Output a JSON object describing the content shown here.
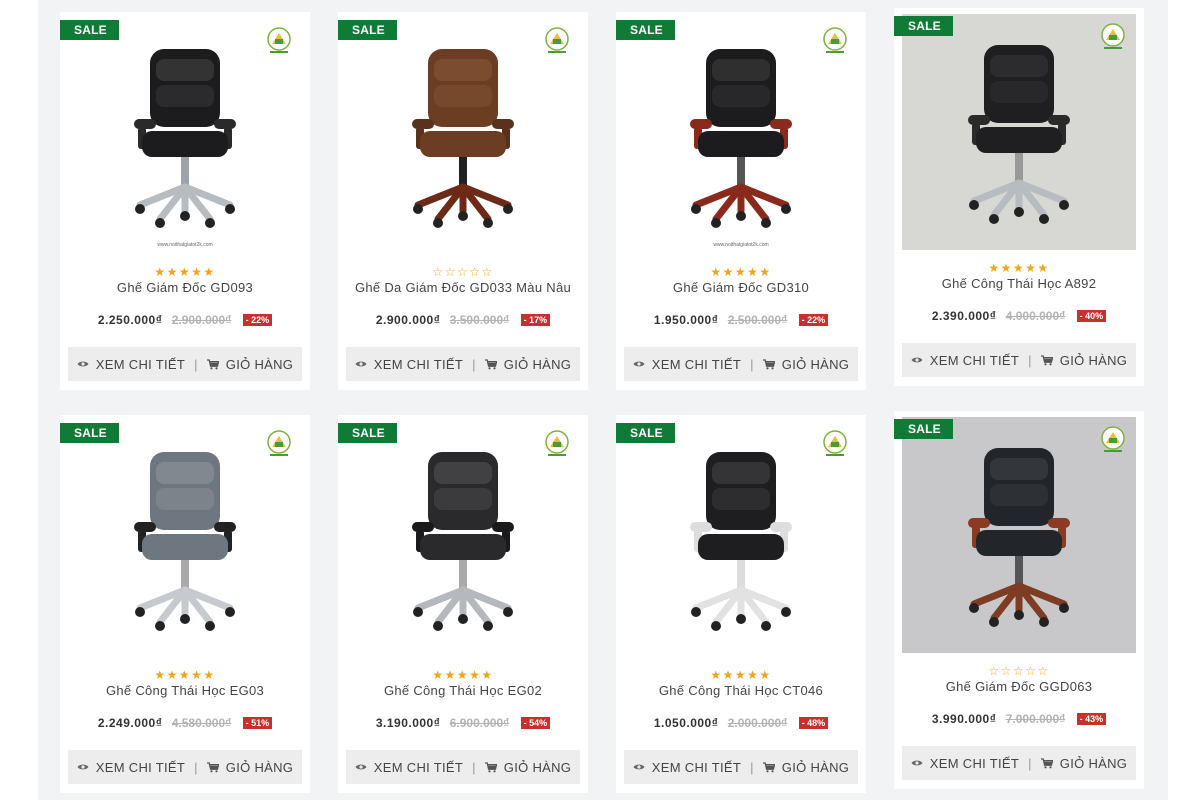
{
  "products": [
    {
      "name": "Ghế Giám Đốc GD093",
      "price": "2.250.000₫",
      "old_price": "2.900.000₫",
      "discount": "- 22%",
      "sale": "SALE",
      "rating": 5,
      "watermark": "www.noithatgiatot2k.com",
      "bg": "white"
    },
    {
      "name": "Ghế Da Giám Đốc GD033 Màu Nâu",
      "price": "2.900.000₫",
      "old_price": "3.500.000₫",
      "discount": "- 17%",
      "sale": "SALE",
      "rating": 0,
      "watermark": "",
      "bg": "white"
    },
    {
      "name": "Ghế Giám Đốc GD310",
      "price": "1.950.000₫",
      "old_price": "2.500.000₫",
      "discount": "- 22%",
      "sale": "SALE",
      "rating": 5,
      "watermark": "www.noithatgiatot2k.com",
      "bg": "white"
    },
    {
      "name": "Ghế Công Thái Học A892",
      "price": "2.390.000₫",
      "old_price": "4.000.000₫",
      "discount": "- 40%",
      "sale": "SALE",
      "rating": 5,
      "watermark": "",
      "bg": "room"
    },
    {
      "name": "Ghế Công Thái Học EG03",
      "price": "2.249.000₫",
      "old_price": "4.580.000₫",
      "discount": "- 51%",
      "sale": "SALE",
      "rating": 5,
      "watermark": "",
      "bg": "white"
    },
    {
      "name": "Ghế Công Thái Học EG02",
      "price": "3.190.000₫",
      "old_price": "6.900.000₫",
      "discount": "- 54%",
      "sale": "SALE",
      "rating": 5,
      "watermark": "",
      "bg": "white"
    },
    {
      "name": "Ghế Công Thái Học CT046",
      "price": "1.050.000₫",
      "old_price": "2.000.000₫",
      "discount": "- 48%",
      "sale": "SALE",
      "rating": 5,
      "watermark": "",
      "bg": "white"
    },
    {
      "name": "Ghế Giám Đốc GGD063",
      "price": "3.990.000₫",
      "old_price": "7.000.000₫",
      "discount": "- 43%",
      "sale": "SALE",
      "rating": 0,
      "watermark": "",
      "bg": "grey"
    }
  ],
  "actions": {
    "detail_label": "XEM CHI TIẾT",
    "cart_label": "GIỎ HÀNG",
    "separator": "|"
  },
  "icons": {
    "detail": "eye-icon",
    "cart": "cart-icon",
    "logo": "brand-logo",
    "star": "star-icon"
  },
  "colors": {
    "sale_badge": "#0f7b37",
    "discount_badge": "#c8302c",
    "star": "#f0a31c",
    "page_bg": "#f2f3f5",
    "action_bg": "#ededed"
  }
}
